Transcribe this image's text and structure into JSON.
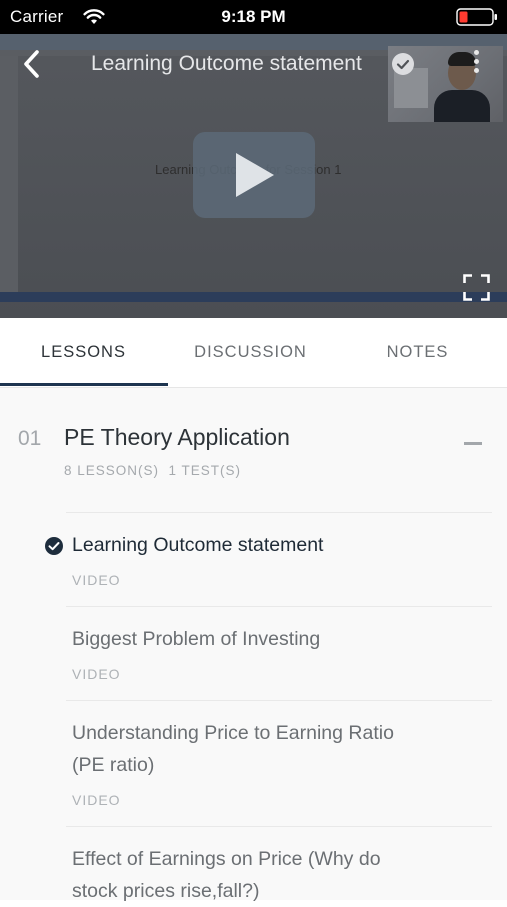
{
  "status_bar": {
    "carrier": "Carrier",
    "time": "9:18 PM",
    "battery_color": "#ff3b30"
  },
  "player": {
    "title": "Learning Outcome statement",
    "slide_text": "Learning Outcome for Session 1",
    "back_icon": "chevron-left-icon",
    "more_icon": "more-vertical-icon",
    "play_icon": "play-icon",
    "fullscreen_icon": "fullscreen-icon"
  },
  "tabs": [
    {
      "label": "LESSONS",
      "active": true
    },
    {
      "label": "DISCUSSION",
      "active": false
    },
    {
      "label": "NOTES",
      "active": false
    }
  ],
  "section": {
    "number": "01",
    "title": "PE Theory Application",
    "meta": "8 LESSON(S)  1 TEST(S)",
    "collapse_icon": "minus-icon"
  },
  "lessons": [
    {
      "title": "Learning Outcome statement",
      "type": "VIDEO",
      "completed": true,
      "current": true
    },
    {
      "title": "Biggest Problem of Investing",
      "type": "VIDEO",
      "completed": false,
      "current": false
    },
    {
      "title_line1": "Understanding Price to Earning Ratio",
      "title_line2": "(PE ratio)",
      "type": "VIDEO",
      "completed": false,
      "current": false
    },
    {
      "title_line1": "Effect of Earnings on Price (Why do",
      "title_line2": "stock prices rise,fall?)",
      "completed": false,
      "current": false
    }
  ],
  "colors": {
    "accent": "#1e3550",
    "text_primary": "#2d3338",
    "text_secondary": "#6b6f73",
    "text_muted": "#a5a9ad"
  }
}
